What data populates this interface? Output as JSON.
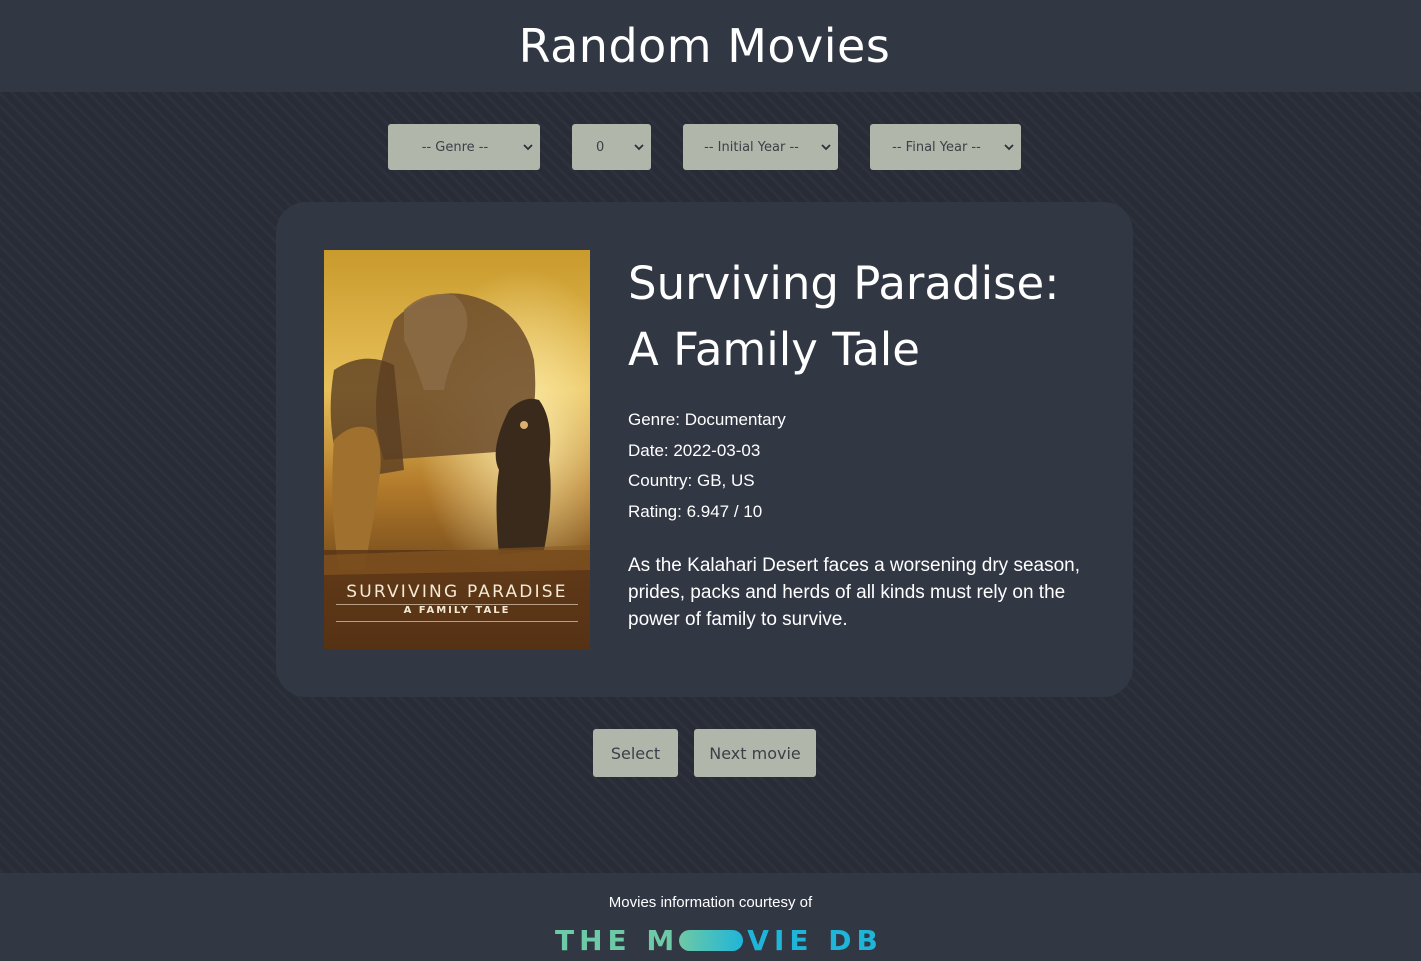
{
  "app": {
    "title": "Random Movies"
  },
  "filters": {
    "genre": {
      "selected": "-- Genre --"
    },
    "count": {
      "selected": "0"
    },
    "initial_year": {
      "selected": "-- Initial Year --"
    },
    "final_year": {
      "selected": "-- Final Year --"
    }
  },
  "movie": {
    "title_line1": "Surviving Paradise:",
    "title_line2": "A Family Tale",
    "genre": "Genre: Documentary",
    "date": "Date: 2022-03-03",
    "country": "Country: GB, US",
    "rating": "Rating: 6.947 / 10",
    "overview": "As the Kalahari Desert faces a worsening dry season, prides, packs and herds of all kinds must rely on the power of family to survive.",
    "poster": {
      "title": "SURVIVING PARADISE",
      "subtitle": "A FAMILY TALE"
    }
  },
  "actions": {
    "select_label": "Select",
    "next_label": "Next movie"
  },
  "footer": {
    "courtesy": "Movies information courtesy of",
    "logo_part1": "THE M",
    "logo_part2": "VIE DB"
  },
  "colors": {
    "background": "#272c37",
    "panel": "#323744",
    "control": "#b1b6ab",
    "control_text": "#3c4048",
    "tmdb_green": "#6ec9a6",
    "tmdb_blue": "#1fb5d8"
  },
  "icons": {
    "dropdown": "chevron-down-icon"
  }
}
